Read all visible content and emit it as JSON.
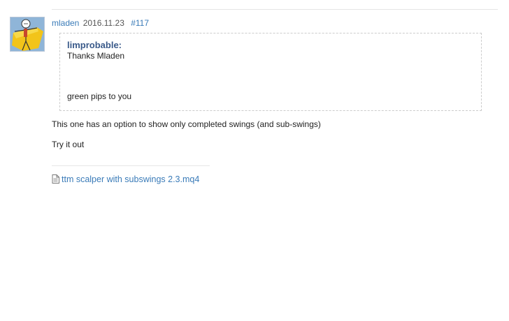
{
  "post": {
    "author": "mladen",
    "date": "2016.11.23",
    "number": "#117",
    "quote": {
      "author": "limprobable:",
      "line1": "Thanks Mladen",
      "line2": "green pips to you"
    },
    "body": [
      "This one has an option to show only completed swings (and sub-swings)",
      "Try it out"
    ],
    "attachment": {
      "icon": "file-icon",
      "filename": "ttm scalper with subswings 2.3.mq4"
    }
  },
  "colors": {
    "link": "#3a7bb8",
    "quote_author": "#3a5a8a",
    "quote_border": "#cccccc"
  }
}
